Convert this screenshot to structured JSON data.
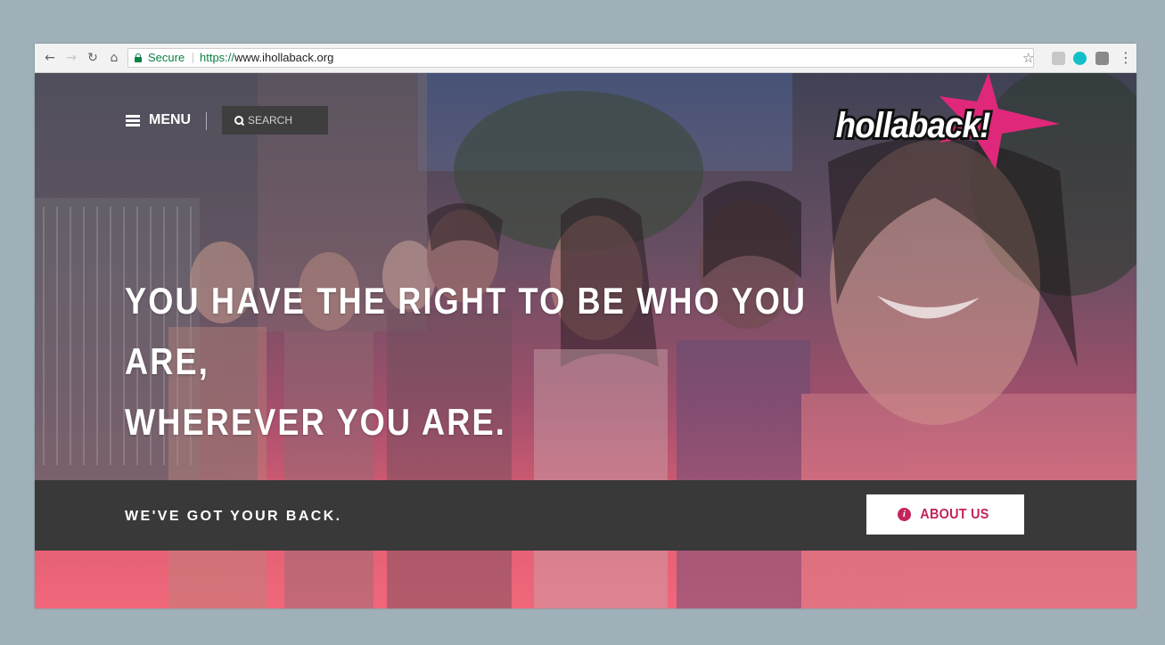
{
  "browser": {
    "secure_label": "Secure",
    "url_scheme": "https://",
    "url_host": "www.ihollaback.org",
    "icons": [
      "back-icon",
      "forward-icon",
      "reload-icon",
      "home-icon",
      "lock-icon",
      "bookmark-star-icon",
      "extension-icons",
      "menu-kebab-icon"
    ]
  },
  "header": {
    "menu_label": "MENU",
    "search_placeholder": "SEARCH",
    "logo_text": "hollaback!"
  },
  "hero": {
    "headline_line1": "YOU HAVE THE RIGHT TO BE WHO YOU ARE,",
    "headline_line2": "WHEREVER YOU ARE."
  },
  "band": {
    "tagline": "WE'VE GOT YOUR BACK.",
    "about_label": "ABOUT US"
  },
  "colors": {
    "accent_pink": "#c4235c",
    "star_pink": "#e0287a",
    "band_dark": "#393939",
    "page_bg": "#9fb0b9"
  }
}
